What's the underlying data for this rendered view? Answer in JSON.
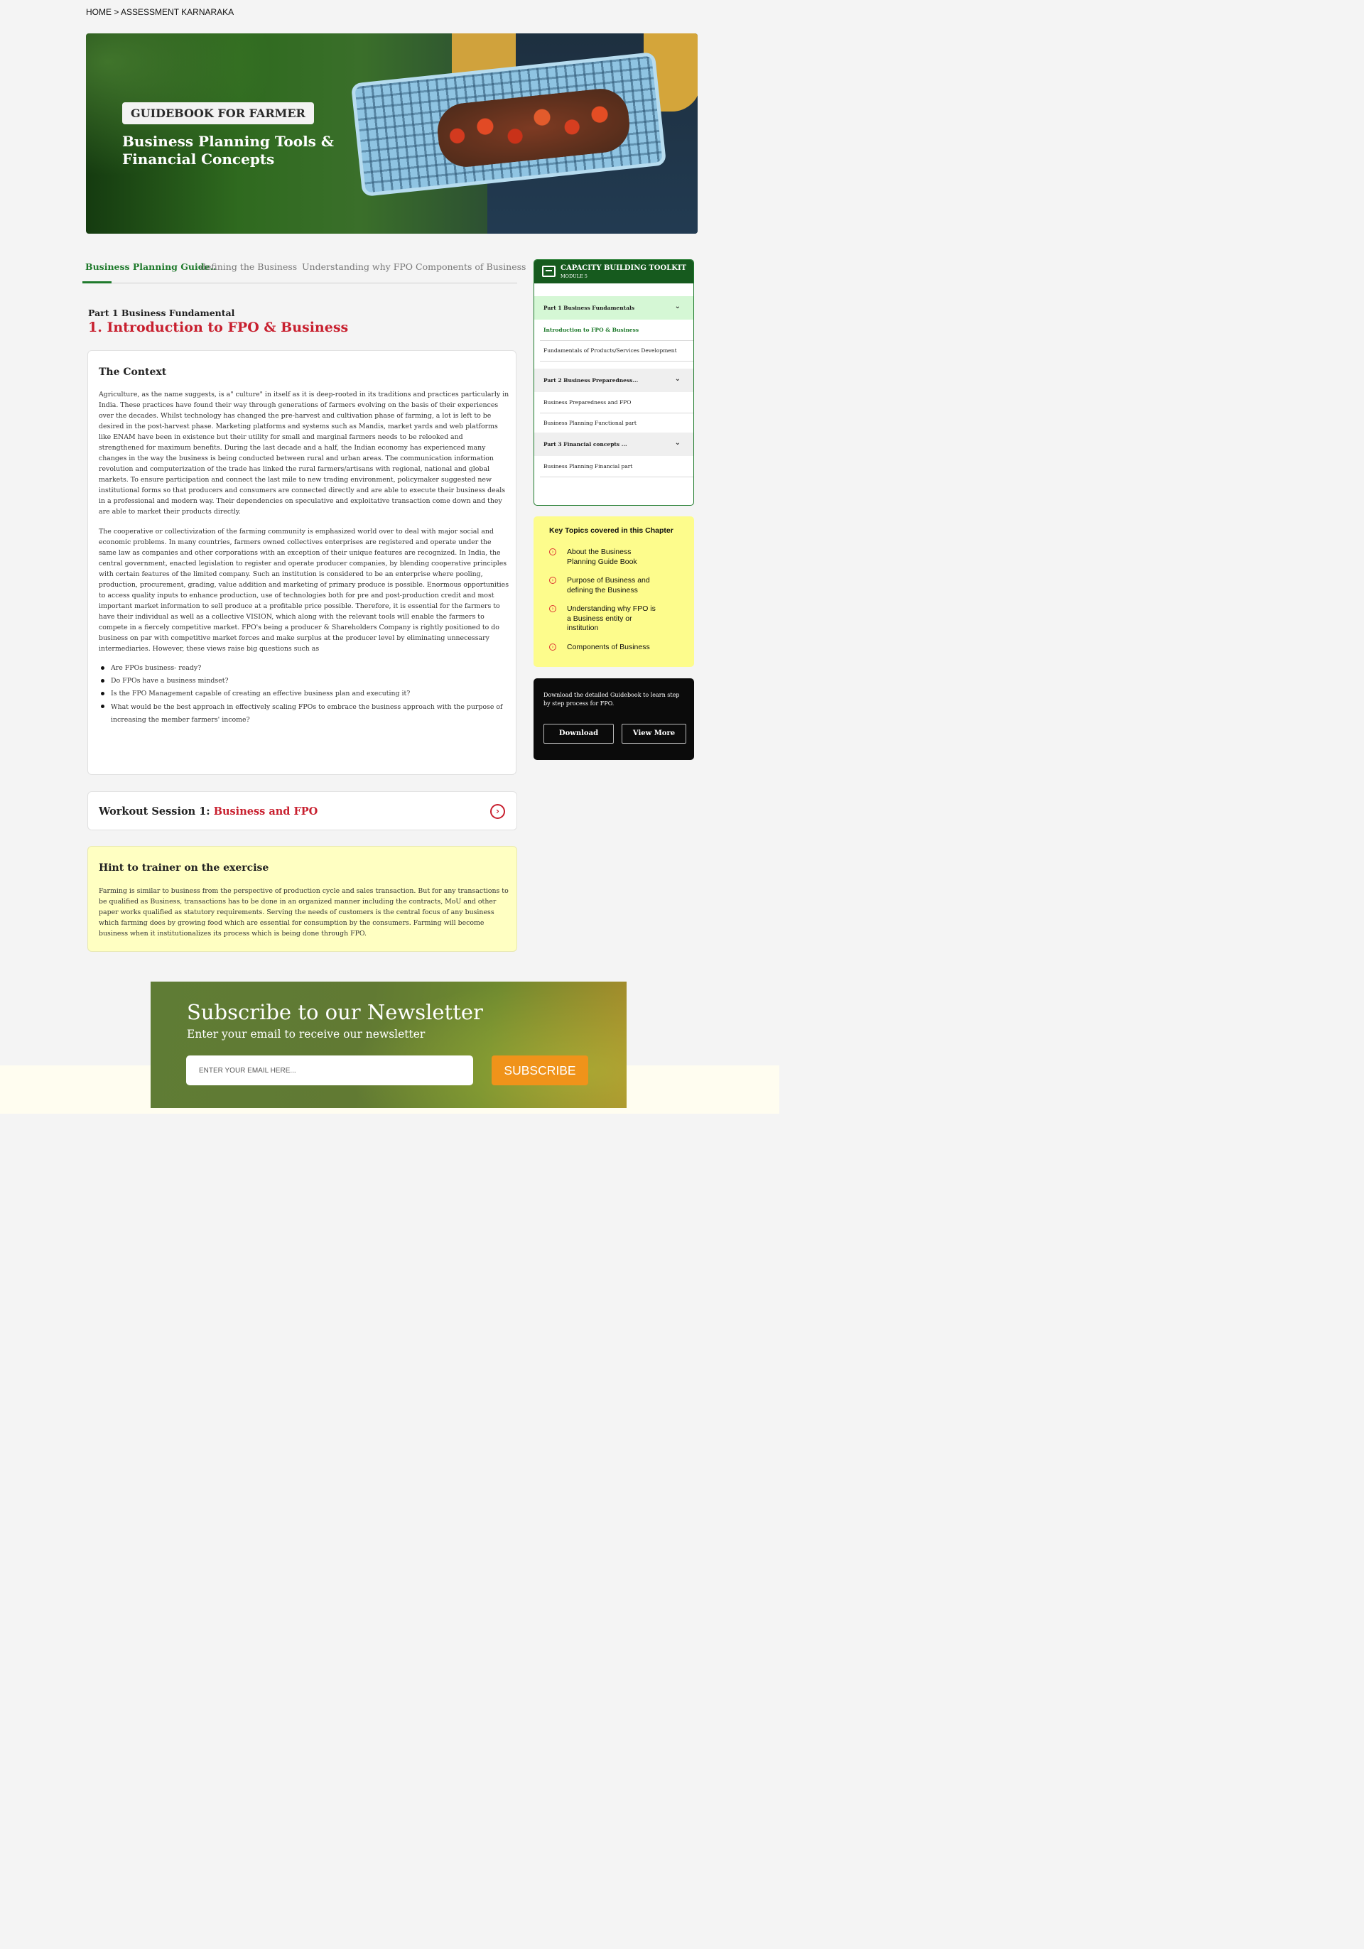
{
  "breadcrumb": "HOME > ASSESSMENT KARNARAKA",
  "hero": {
    "badge": "GUIDEBOOK FOR FARMER",
    "subtitle": "Business Planning Tools & Financial Concepts"
  },
  "tabs": [
    {
      "label": "Business Planning Guide..",
      "active": true
    },
    {
      "label": "defining the Business"
    },
    {
      "label": "Understanding why FPO"
    },
    {
      "label": "Components of Business"
    }
  ],
  "chapter": {
    "part": "Part 1 Business Fundamental",
    "title": "1. Introduction to FPO & Business"
  },
  "context": {
    "heading": "The Context",
    "paragraph1": "Agriculture, as the name suggests, is a\" culture\" in itself as it is deep-rooted in its traditions and practices particularly in India. These practices have found their way through generations of farmers evolving on the basis of their experiences over the decades. Whilst technology has changed the pre-harvest and cultivation phase of farming, a lot is left to be desired in the post-harvest phase. Marketing platforms and systems such as Mandis, market yards and web platforms like ENAM have been in existence but their utility for small and marginal farmers needs to be relooked and strengthened for maximum benefits. During the last decade and a half, the Indian economy has experienced many changes in the way the business is being conducted between rural and urban areas. The communication information revolution and computerization of the trade has linked the rural farmers/artisans with regional, national and global markets. To ensure participation and connect the last mile to new trading environment, policymaker suggested new institutional forms so that producers and consumers are connected directly and are able to execute their business deals in a professional and modern way. Their dependencies on speculative and exploitative transaction come down and they are able to market their products directly.",
    "paragraph2": "The cooperative or collectivization of the farming community is emphasized world over to deal with major social and economic problems. In many countries, farmers owned collectives enterprises are registered and operate under the same law as companies and other corporations with an exception of their unique features are recognized. In India, the central government, enacted legislation to register and operate producer companies, by blending cooperative principles with certain features of the limited company. Such an institution is considered to be an enterprise where pooling, production, procurement, grading, value addition and marketing of primary produce is possible. Enormous opportunities to access quality inputs to enhance production, use of technologies both for pre and post-production credit and most important market information to sell produce at a profitable price possible. Therefore, it is essential for the farmers to have their individual as well as a collective VISION, which along with the relevant tools will enable the farmers to compete in a fiercely competitive market. FPO's being a producer & Shareholders Company is rightly positioned to do business on par with competitive market forces and make surplus at the producer level by eliminating unnecessary intermediaries. However, these views raise big questions such as",
    "questions": [
      "Are FPOs business- ready?",
      "Do FPOs have a business mindset?",
      "Is the FPO Management capable of creating an effective business plan and executing it?",
      "What would be the best approach in effectively scaling FPOs to embrace the business approach with the purpose of increasing the member farmers' income?"
    ]
  },
  "workout": {
    "prefix": "Workout Session 1:",
    "title": "Business and FPO",
    "icon": "chevron-right-circle-icon"
  },
  "hint": {
    "heading": "Hint to trainer on the exercise",
    "body": "Farming is similar to business from the perspective of production cycle and sales transaction. But for any transactions to be qualified as Business, transactions has to be done in an organized manner including the contracts, MoU and other paper works qualified as statutory requirements. Serving the needs of customers is the central focus of any business which farming does by growing food which are essential for consumption by the consumers. Farming will become business when it institutionalizes its process which is being done through FPO."
  },
  "toolkit": {
    "title": "CAPACITY BUILDING TOOLKIT",
    "module": "MODULE 5",
    "part1": "Part 1  Business Fundamentals",
    "part1_items": [
      "Introduction to FPO & Business",
      "Fundamentals of Products/Services Development"
    ],
    "part2": "Part 2 Business Preparedness...",
    "part2_items": [
      "Business Preparedness and FPO",
      "Business Planning Functional part"
    ],
    "part3": "Part 3  Financial concepts ...",
    "part3_items": [
      "Business Planning Financial part"
    ],
    "chevron": "⌄"
  },
  "topics": {
    "heading": "Key Topics covered in this Chapter",
    "items": [
      "About the Business Planning Guide Book",
      "Purpose of Business and defining the Business",
      "Understanding why FPO is a Business entity or institution",
      "Components of Business"
    ]
  },
  "download": {
    "text": "Download the detailed Guidebook to learn step by step process for FPO.",
    "download_label": "Download",
    "view_more_label": "View More"
  },
  "newsletter": {
    "title": "Subscribe to our Newsletter",
    "subtitle": "Enter your email to receive our newsletter",
    "placeholder": "ENTER YOUR EMAIL HERE...",
    "button": "SUBSCRIBE"
  },
  "colors": {
    "brand_green": "#165a1e",
    "accent_red": "#c8202f",
    "subscribe_orange": "#f0931a",
    "topics_yellow": "#fdfc8c"
  }
}
